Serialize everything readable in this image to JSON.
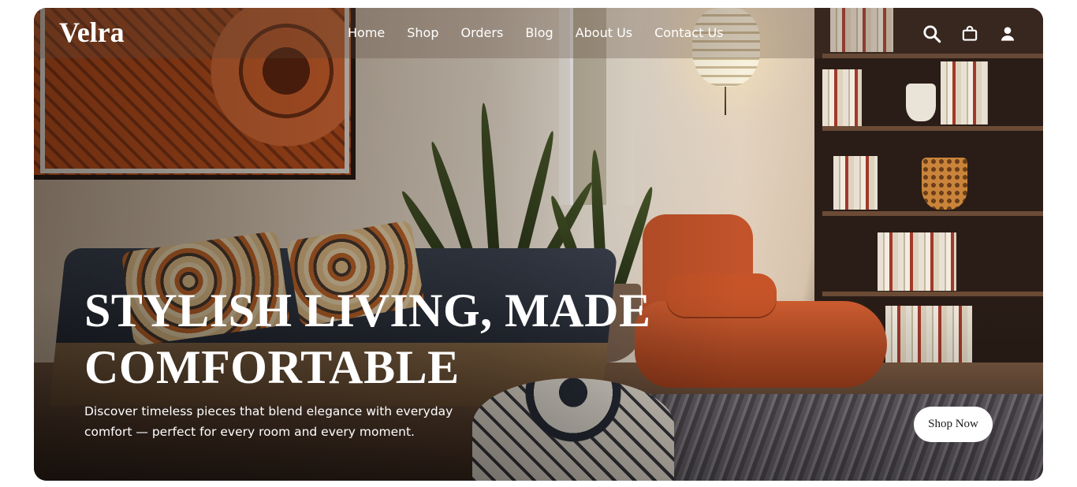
{
  "brand": {
    "name": "Velra"
  },
  "nav": {
    "items": [
      {
        "label": "Home"
      },
      {
        "label": "Shop"
      },
      {
        "label": "Orders"
      },
      {
        "label": "Blog"
      },
      {
        "label": "About Us"
      },
      {
        "label": "Contact Us"
      }
    ]
  },
  "header_icons": [
    "search-icon",
    "shopping-bag-icon",
    "user-icon"
  ],
  "hero": {
    "headline_line1": "STYLISH LIVING, MADE",
    "headline_line2": "COMFORTABLE",
    "subtitle_line1": "Discover timeless pieces that blend elegance with everyday",
    "subtitle_line2": "comfort — perfect for every room and every moment.",
    "cta_label": "Shop Now",
    "image_subject": "living room with sofa, orange lounge chair, plants, bookshelf and pendant lamp"
  },
  "colors": {
    "text_on_image": "#ffffff",
    "cta_background": "#ffffff",
    "cta_text": "#1a1a1a",
    "accent_orange": "#c65428"
  }
}
